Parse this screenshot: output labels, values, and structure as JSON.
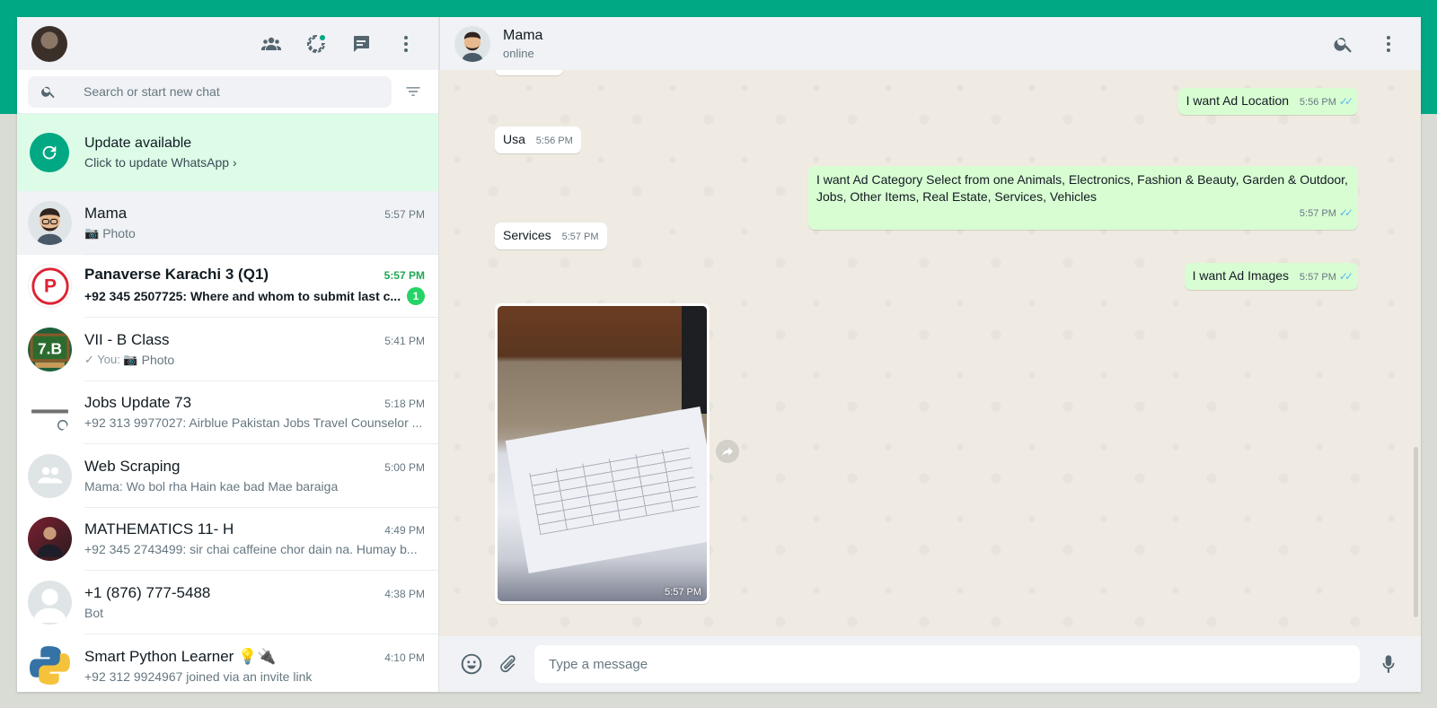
{
  "colors": {
    "accent": "#00a884",
    "outgoing_bubble": "#d9fdd3",
    "incoming_bubble": "#ffffff",
    "unread_green": "#25d366",
    "read_ticks": "#53bdeb"
  },
  "sidebar": {
    "header_icons": [
      "communities-icon",
      "status-icon",
      "new-chat-icon",
      "menu-icon"
    ],
    "search": {
      "placeholder": "Search or start new chat"
    },
    "update": {
      "title": "Update available",
      "subtitle": "Click to update WhatsApp ›"
    },
    "chats": [
      {
        "name": "Mama",
        "time": "5:57 PM",
        "preview_icon": "📷",
        "preview": "Photo"
      },
      {
        "name": "Panaverse Karachi 3 (Q1)",
        "time": "5:57 PM",
        "preview": "+92 345 2507725: Where and whom to submit last c...",
        "unread": "1"
      },
      {
        "name": "VII - B Class",
        "time": "5:41 PM",
        "preview_icon": "✓ You: 📷",
        "preview": "Photo"
      },
      {
        "name": "Jobs Update 73",
        "time": "5:18 PM",
        "preview": "+92 313 9977027: Airblue Pakistan Jobs Travel Counselor ..."
      },
      {
        "name": "Web Scraping",
        "time": "5:00 PM",
        "preview": "Mama: Wo bol rha Hain kae bad Mae baraiga"
      },
      {
        "name": "MATHEMATICS 11- H",
        "time": "4:49 PM",
        "preview": "+92 345 2743499: sir chai caffeine chor dain na. Humay b..."
      },
      {
        "name": "+1 (876) 777-5488",
        "time": "4:38 PM",
        "preview": "Bot"
      },
      {
        "name": "Smart Python Learner 💡🔌",
        "time": "4:10 PM",
        "preview": "+92 312 9924967 joined via an invite link"
      }
    ]
  },
  "conversation": {
    "contact": {
      "name": "Mama",
      "status": "online"
    },
    "messages": [
      {
        "dir": "out",
        "text": "I want Ad Location",
        "time": "5:56 PM"
      },
      {
        "dir": "in",
        "text": "Usa",
        "time": "5:56 PM"
      },
      {
        "dir": "out",
        "text": "I want Ad Category Select from one Animals, Electronics, Fashion & Beauty, Garden & Outdoor, Jobs, Other Items, Real Estate, Services, Vehicles",
        "time": "5:57 PM"
      },
      {
        "dir": "in",
        "text": "Services",
        "time": "5:57 PM"
      },
      {
        "dir": "out",
        "text": "I want Ad Images",
        "time": "5:57 PM"
      },
      {
        "dir": "in",
        "type": "photo",
        "time": "5:57 PM"
      }
    ],
    "composer": {
      "placeholder": "Type a message"
    }
  }
}
